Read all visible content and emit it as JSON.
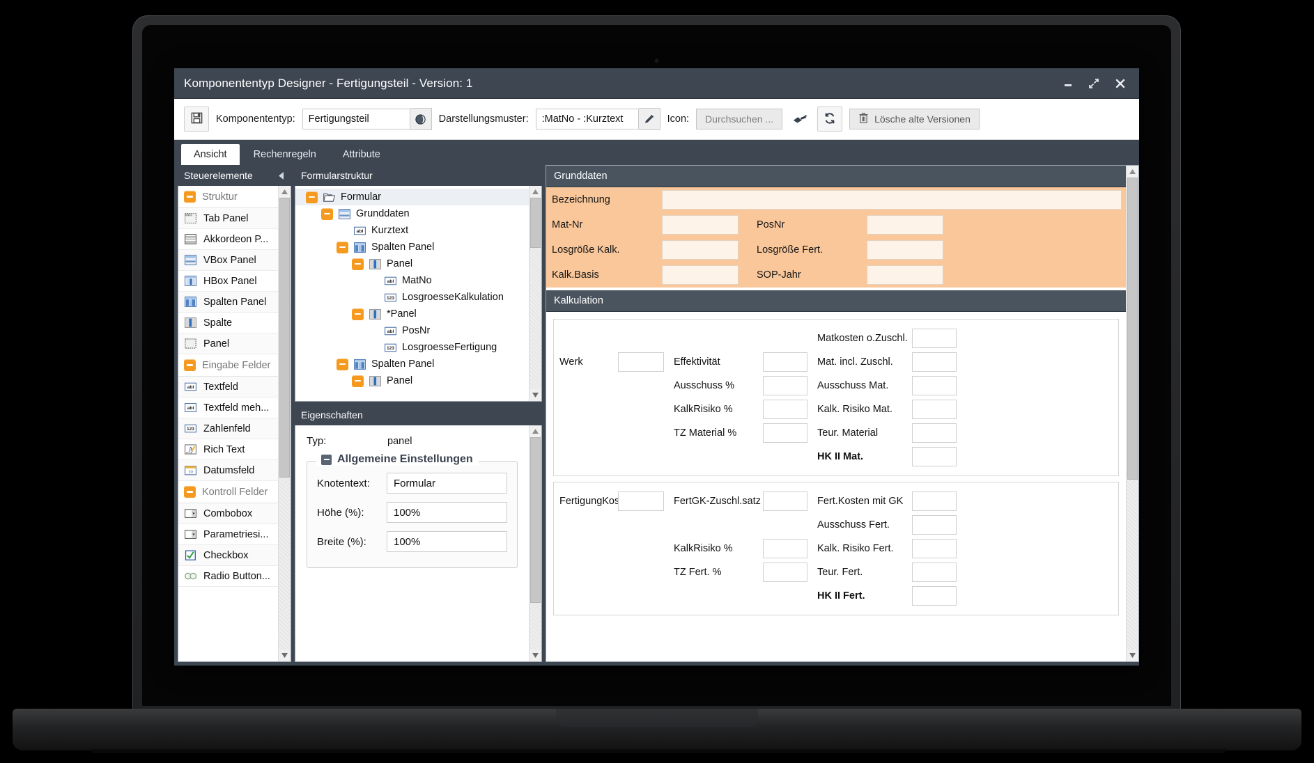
{
  "window": {
    "title": "Komponententyp Designer - Fertigungsteil - Version: 1",
    "minimize_label": "minimize",
    "maximize_label": "restore",
    "close_label": "close"
  },
  "toolbar": {
    "save_title": "Speichern",
    "komponententyp_label": "Komponententyp:",
    "komponententyp_value": "Fertigungsteil",
    "globe_title": "Sprachen",
    "darstellungsmuster_label": "Darstellungsmuster:",
    "darstellungsmuster_value": ":MatNo - :Kurztext",
    "edit_title": "Bearbeiten",
    "icon_label": "Icon:",
    "icon_browse_label": "Durchsuchen ...",
    "clear_title": "Zurücksetzen",
    "refresh_title": "Aktualisieren",
    "delete_versions_label": "Lösche alte Versionen"
  },
  "tabs": [
    {
      "label": "Ansicht",
      "active": true
    },
    {
      "label": "Rechenregeln",
      "active": false
    },
    {
      "label": "Attribute",
      "active": false
    }
  ],
  "palette": {
    "title": "Steuerelemente",
    "groups": [
      {
        "label": "Struktur",
        "items": [
          {
            "label": "Tab Panel",
            "icon": "tab-panel-icon"
          },
          {
            "label": "Akkordeon P...",
            "icon": "accordion-panel-icon"
          },
          {
            "label": "VBox Panel",
            "icon": "vbox-panel-icon"
          },
          {
            "label": "HBox Panel",
            "icon": "hbox-panel-icon"
          },
          {
            "label": "Spalten Panel",
            "icon": "columns-panel-icon"
          },
          {
            "label": "Spalte",
            "icon": "column-icon"
          },
          {
            "label": "Panel",
            "icon": "panel-icon"
          }
        ]
      },
      {
        "label": "Eingabe Felder",
        "items": [
          {
            "label": "Textfeld",
            "icon": "textfield-icon"
          },
          {
            "label": "Textfeld meh...",
            "icon": "textarea-icon"
          },
          {
            "label": "Zahlenfeld",
            "icon": "numberfield-icon"
          },
          {
            "label": "Rich Text",
            "icon": "richtext-icon"
          },
          {
            "label": "Datumsfeld",
            "icon": "datefield-icon"
          }
        ]
      },
      {
        "label": "Kontroll Felder",
        "items": [
          {
            "label": "Combobox",
            "icon": "combobox-icon"
          },
          {
            "label": "Parametriesi...",
            "icon": "combobox-icon"
          },
          {
            "label": "Checkbox",
            "icon": "checkbox-icon"
          },
          {
            "label": "Radio Button...",
            "icon": "radiobutton-icon"
          }
        ]
      }
    ]
  },
  "tree": {
    "title": "Formularstruktur",
    "nodes": [
      {
        "label": "Formular",
        "depth": 0,
        "toggle": "minus",
        "icon": "folder-icon",
        "selected": true
      },
      {
        "label": "Grunddaten",
        "depth": 1,
        "toggle": "minus",
        "icon": "vbox-panel-icon",
        "selected": false
      },
      {
        "label": "Kurztext",
        "depth": 2,
        "toggle": "none",
        "icon": "textfield-icon",
        "selected": false
      },
      {
        "label": "Spalten Panel",
        "depth": 2,
        "toggle": "minus",
        "icon": "columns-panel-icon",
        "selected": false
      },
      {
        "label": "Panel",
        "depth": 3,
        "toggle": "minus",
        "icon": "column-icon",
        "selected": false
      },
      {
        "label": "MatNo",
        "depth": 4,
        "toggle": "none",
        "icon": "textfield-icon",
        "selected": false
      },
      {
        "label": "LosgroesseKalkulation",
        "depth": 4,
        "toggle": "none",
        "icon": "numberfield-icon",
        "selected": false
      },
      {
        "label": "*Panel",
        "depth": 3,
        "toggle": "minus",
        "icon": "column-icon",
        "selected": false
      },
      {
        "label": "PosNr",
        "depth": 4,
        "toggle": "none",
        "icon": "textfield-icon",
        "selected": false
      },
      {
        "label": "LosgroesseFertigung",
        "depth": 4,
        "toggle": "none",
        "icon": "numberfield-icon",
        "selected": false
      },
      {
        "label": "Spalten Panel",
        "depth": 2,
        "toggle": "minus",
        "icon": "columns-panel-icon",
        "selected": false
      },
      {
        "label": "Panel",
        "depth": 3,
        "toggle": "minus",
        "icon": "column-icon",
        "selected": false
      }
    ]
  },
  "properties": {
    "title": "Eigenschaften",
    "typ_label": "Typ:",
    "typ_value": "panel",
    "fieldset_label": "Allgemeine Einstellungen",
    "fields": [
      {
        "label": "Knotentext:",
        "value": "Formular"
      },
      {
        "label": "Höhe (%):",
        "value": "100%"
      },
      {
        "label": "Breite (%):",
        "value": "100%"
      }
    ]
  },
  "preview": {
    "grunddaten": {
      "title": "Grunddaten",
      "rows": [
        [
          {
            "label": "Bezeichnung",
            "wide": true
          }
        ],
        [
          {
            "label": "Mat-Nr"
          },
          {
            "label": "PosNr"
          }
        ],
        [
          {
            "label": "Losgröße Kalk."
          },
          {
            "label": "Losgröße Fert."
          }
        ],
        [
          {
            "label": "Kalk.Basis"
          },
          {
            "label": "SOP-Jahr"
          }
        ]
      ]
    },
    "kalkulation": {
      "title": "Kalkulation",
      "material_block": [
        {
          "c1": "",
          "c2": "",
          "c3": "Matkosten o.Zuschl.",
          "c2_input": false,
          "c1_input": false,
          "c3_input": true,
          "bold": false
        },
        {
          "c1": "Werk",
          "c2": "Effektivität",
          "c3": "Mat. incl. Zuschl.",
          "c1_input": true,
          "c2_input": true,
          "c3_input": true,
          "bold": false
        },
        {
          "c1": "",
          "c2": "Ausschuss %",
          "c3": "Ausschuss Mat.",
          "c1_input": false,
          "c2_input": true,
          "c3_input": true,
          "bold": false
        },
        {
          "c1": "",
          "c2": "KalkRisiko %",
          "c3": "Kalk. Risiko Mat.",
          "c1_input": false,
          "c2_input": true,
          "c3_input": true,
          "bold": false
        },
        {
          "c1": "",
          "c2": "TZ Material %",
          "c3": "Teur. Material",
          "c1_input": false,
          "c2_input": true,
          "c3_input": true,
          "bold": false
        },
        {
          "c1": "",
          "c2": "",
          "c3": "HK II Mat.",
          "c1_input": false,
          "c2_input": false,
          "c3_input": true,
          "bold": true
        }
      ],
      "fertigung_block": [
        {
          "c1": "FertigungKosten",
          "c2": "FertGK-Zuschl.satz",
          "c3": "Fert.Kosten mit GK",
          "c1_input": true,
          "c2_input": true,
          "c3_input": true,
          "bold": false
        },
        {
          "c1": "",
          "c2": "",
          "c3": "Ausschuss Fert.",
          "c1_input": false,
          "c2_input": false,
          "c3_input": true,
          "bold": false
        },
        {
          "c1": "",
          "c2": "KalkRisiko %",
          "c3": "Kalk. Risiko Fert.",
          "c1_input": false,
          "c2_input": true,
          "c3_input": true,
          "bold": false
        },
        {
          "c1": "",
          "c2": "TZ Fert. %",
          "c3": "Teur. Fert.",
          "c1_input": false,
          "c2_input": true,
          "c3_input": true,
          "bold": false
        },
        {
          "c1": "",
          "c2": "",
          "c3": "HK II Fert.",
          "c1_input": false,
          "c2_input": false,
          "c3_input": true,
          "bold": true
        }
      ]
    }
  },
  "colors": {
    "titlebar": "#3e4652",
    "section_header": "#4a545f",
    "accent_orange": "#f59a1e",
    "form_orange": "#fac79a",
    "form_field": "#fdf3e8"
  }
}
